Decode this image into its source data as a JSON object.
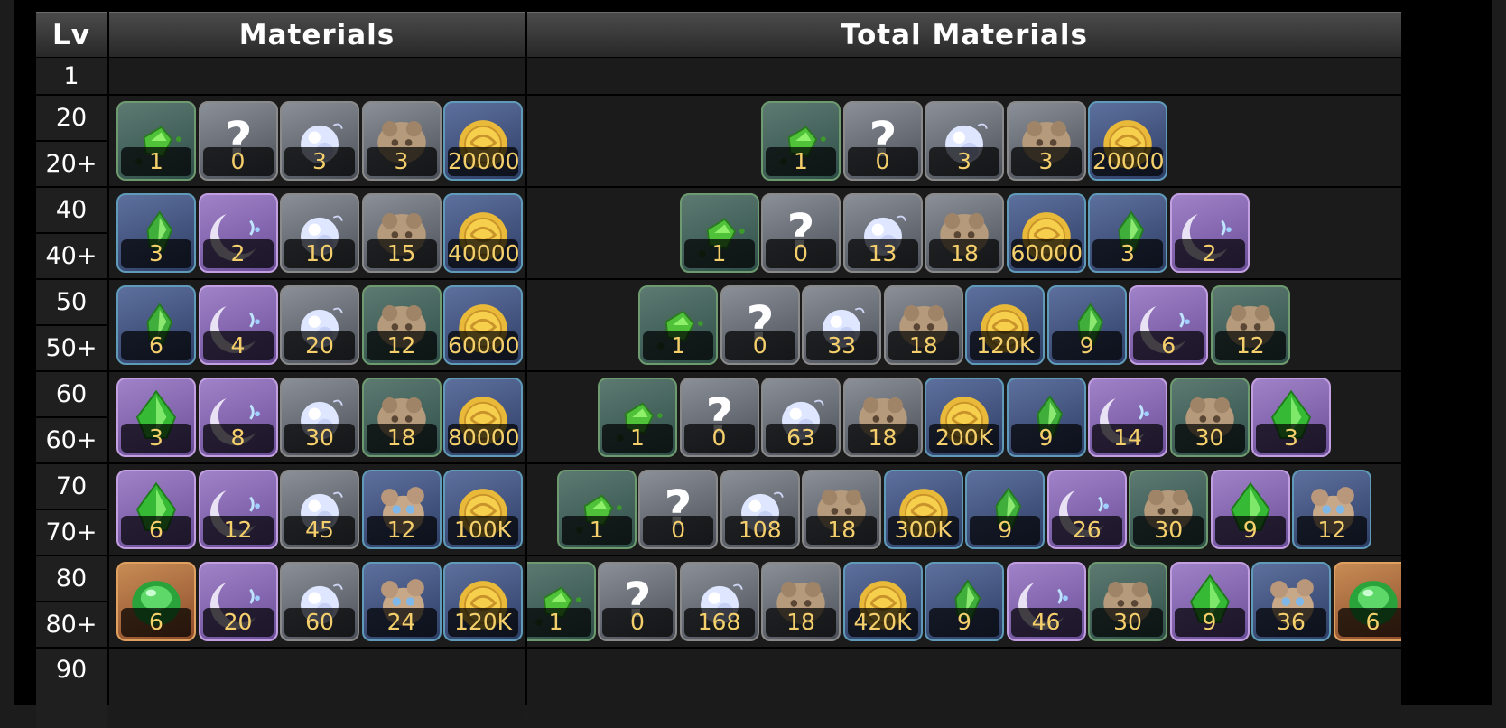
{
  "headers": {
    "lv": "Lv",
    "materials": "Materials",
    "total": "Total Materials"
  },
  "rows": [
    {
      "lv": "1",
      "materials": [],
      "total": []
    },
    {
      "lv": "20",
      "lv_plus": "20+",
      "materials": [
        {
          "icon": "shard-green-icon",
          "rarity": "green",
          "count": "1"
        },
        {
          "icon": "unknown-icon",
          "rarity": "gray",
          "count": "0"
        },
        {
          "icon": "pearl-icon",
          "rarity": "gray",
          "count": "3"
        },
        {
          "icon": "creature-icon",
          "rarity": "gray",
          "count": "3"
        },
        {
          "icon": "coin-icon",
          "rarity": "blue",
          "count": "20000"
        }
      ],
      "total": [
        {
          "icon": "shard-green-icon",
          "rarity": "green",
          "count": "1"
        },
        {
          "icon": "unknown-icon",
          "rarity": "gray",
          "count": "0"
        },
        {
          "icon": "pearl-icon",
          "rarity": "gray",
          "count": "3"
        },
        {
          "icon": "creature-icon",
          "rarity": "gray",
          "count": "3"
        },
        {
          "icon": "coin-icon",
          "rarity": "blue",
          "count": "20000"
        }
      ]
    },
    {
      "lv": "40",
      "lv_plus": "40+",
      "materials": [
        {
          "icon": "fragment-green-icon",
          "rarity": "blue",
          "count": "3"
        },
        {
          "icon": "crescent-icon",
          "rarity": "purple",
          "count": "2"
        },
        {
          "icon": "pearl-icon",
          "rarity": "gray",
          "count": "10"
        },
        {
          "icon": "creature-icon",
          "rarity": "gray",
          "count": "15"
        },
        {
          "icon": "coin-icon",
          "rarity": "blue",
          "count": "40000"
        }
      ],
      "total": [
        {
          "icon": "shard-green-icon",
          "rarity": "green",
          "count": "1"
        },
        {
          "icon": "unknown-icon",
          "rarity": "gray",
          "count": "0"
        },
        {
          "icon": "pearl-icon",
          "rarity": "gray",
          "count": "13"
        },
        {
          "icon": "creature-icon",
          "rarity": "gray",
          "count": "18"
        },
        {
          "icon": "coin-icon",
          "rarity": "blue",
          "count": "60000"
        },
        {
          "icon": "fragment-green-icon",
          "rarity": "blue",
          "count": "3"
        },
        {
          "icon": "crescent-icon",
          "rarity": "purple",
          "count": "2"
        }
      ]
    },
    {
      "lv": "50",
      "lv_plus": "50+",
      "materials": [
        {
          "icon": "fragment-green-icon",
          "rarity": "blue",
          "count": "6"
        },
        {
          "icon": "crescent-icon",
          "rarity": "purple",
          "count": "4"
        },
        {
          "icon": "pearl-icon",
          "rarity": "gray",
          "count": "20"
        },
        {
          "icon": "creature-icon",
          "rarity": "green",
          "count": "12"
        },
        {
          "icon": "coin-icon",
          "rarity": "blue",
          "count": "60000"
        }
      ],
      "total": [
        {
          "icon": "shard-green-icon",
          "rarity": "green",
          "count": "1"
        },
        {
          "icon": "unknown-icon",
          "rarity": "gray",
          "count": "0"
        },
        {
          "icon": "pearl-icon",
          "rarity": "gray",
          "count": "33"
        },
        {
          "icon": "creature-icon",
          "rarity": "gray",
          "count": "18"
        },
        {
          "icon": "coin-icon",
          "rarity": "blue",
          "count": "120K"
        },
        {
          "icon": "fragment-green-icon",
          "rarity": "blue",
          "count": "9"
        },
        {
          "icon": "crescent-icon",
          "rarity": "purple",
          "count": "6"
        },
        {
          "icon": "creature-icon",
          "rarity": "green",
          "count": "12"
        }
      ]
    },
    {
      "lv": "60",
      "lv_plus": "60+",
      "materials": [
        {
          "icon": "chunk-green-icon",
          "rarity": "purple",
          "count": "3"
        },
        {
          "icon": "crescent-icon",
          "rarity": "purple",
          "count": "8"
        },
        {
          "icon": "pearl-icon",
          "rarity": "gray",
          "count": "30"
        },
        {
          "icon": "creature-icon",
          "rarity": "green",
          "count": "18"
        },
        {
          "icon": "coin-icon",
          "rarity": "blue",
          "count": "80000"
        }
      ],
      "total": [
        {
          "icon": "shard-green-icon",
          "rarity": "green",
          "count": "1"
        },
        {
          "icon": "unknown-icon",
          "rarity": "gray",
          "count": "0"
        },
        {
          "icon": "pearl-icon",
          "rarity": "gray",
          "count": "63"
        },
        {
          "icon": "creature-icon",
          "rarity": "gray",
          "count": "18"
        },
        {
          "icon": "coin-icon",
          "rarity": "blue",
          "count": "200K"
        },
        {
          "icon": "fragment-green-icon",
          "rarity": "blue",
          "count": "9"
        },
        {
          "icon": "crescent-icon",
          "rarity": "purple",
          "count": "14"
        },
        {
          "icon": "creature-icon",
          "rarity": "green",
          "count": "30"
        },
        {
          "icon": "chunk-green-icon",
          "rarity": "purple",
          "count": "3"
        }
      ]
    },
    {
      "lv": "70",
      "lv_plus": "70+",
      "materials": [
        {
          "icon": "chunk-green-icon",
          "rarity": "purple",
          "count": "6"
        },
        {
          "icon": "crescent-icon",
          "rarity": "purple",
          "count": "12"
        },
        {
          "icon": "pearl-icon",
          "rarity": "gray",
          "count": "45"
        },
        {
          "icon": "creature-blue-icon",
          "rarity": "blue",
          "count": "12"
        },
        {
          "icon": "coin-icon",
          "rarity": "blue",
          "count": "100K"
        }
      ],
      "total": [
        {
          "icon": "shard-green-icon",
          "rarity": "green",
          "count": "1"
        },
        {
          "icon": "unknown-icon",
          "rarity": "gray",
          "count": "0"
        },
        {
          "icon": "pearl-icon",
          "rarity": "gray",
          "count": "108"
        },
        {
          "icon": "creature-icon",
          "rarity": "gray",
          "count": "18"
        },
        {
          "icon": "coin-icon",
          "rarity": "blue",
          "count": "300K"
        },
        {
          "icon": "fragment-green-icon",
          "rarity": "blue",
          "count": "9"
        },
        {
          "icon": "crescent-icon",
          "rarity": "purple",
          "count": "26"
        },
        {
          "icon": "creature-icon",
          "rarity": "green",
          "count": "30"
        },
        {
          "icon": "chunk-green-icon",
          "rarity": "purple",
          "count": "9"
        },
        {
          "icon": "creature-blue-icon",
          "rarity": "blue",
          "count": "12"
        }
      ]
    },
    {
      "lv": "80",
      "lv_plus": "80+",
      "materials": [
        {
          "icon": "gem-green-icon",
          "rarity": "orange",
          "count": "6"
        },
        {
          "icon": "crescent-icon",
          "rarity": "purple",
          "count": "20"
        },
        {
          "icon": "pearl-icon",
          "rarity": "gray",
          "count": "60"
        },
        {
          "icon": "creature-blue-icon",
          "rarity": "blue",
          "count": "24"
        },
        {
          "icon": "coin-icon",
          "rarity": "blue",
          "count": "120K"
        }
      ],
      "total": [
        {
          "icon": "shard-green-icon",
          "rarity": "green",
          "count": "1"
        },
        {
          "icon": "unknown-icon",
          "rarity": "gray",
          "count": "0"
        },
        {
          "icon": "pearl-icon",
          "rarity": "gray",
          "count": "168"
        },
        {
          "icon": "creature-icon",
          "rarity": "gray",
          "count": "18"
        },
        {
          "icon": "coin-icon",
          "rarity": "blue",
          "count": "420K"
        },
        {
          "icon": "fragment-green-icon",
          "rarity": "blue",
          "count": "9"
        },
        {
          "icon": "crescent-icon",
          "rarity": "purple",
          "count": "46"
        },
        {
          "icon": "creature-icon",
          "rarity": "green",
          "count": "30"
        },
        {
          "icon": "chunk-green-icon",
          "rarity": "purple",
          "count": "9"
        },
        {
          "icon": "creature-blue-icon",
          "rarity": "blue",
          "count": "36"
        },
        {
          "icon": "gem-green-icon",
          "rarity": "orange",
          "count": "6"
        }
      ]
    },
    {
      "lv": "90",
      "materials": [],
      "total": []
    }
  ]
}
